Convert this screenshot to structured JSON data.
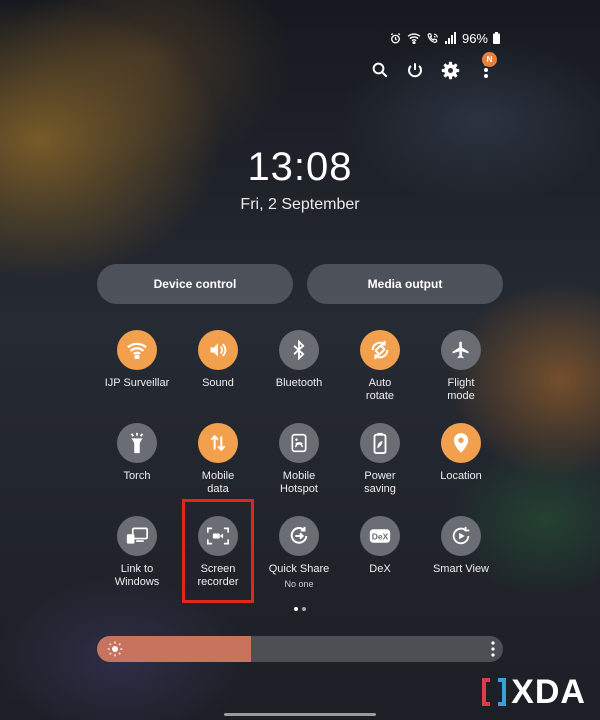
{
  "status_bar": {
    "battery": "96%",
    "icons": [
      "alarm-icon",
      "wifi-icon",
      "wifi-call-icon",
      "signal-icon",
      "battery-icon"
    ]
  },
  "top_actions": [
    "search-icon",
    "power-icon",
    "settings-icon",
    "more-icon"
  ],
  "notification_badge": "N",
  "clock": {
    "time": "13:08",
    "date": "Fri, 2 September"
  },
  "buttons": {
    "device_control": "Device control",
    "media_output": "Media output"
  },
  "tiles": [
    {
      "id": "wifi",
      "label": "IJP Surveillar",
      "icon": "wifi-icon",
      "on": true
    },
    {
      "id": "sound",
      "label": "Sound",
      "icon": "speaker-icon",
      "on": true
    },
    {
      "id": "bluetooth",
      "label": "Bluetooth",
      "icon": "bluetooth-icon",
      "on": false
    },
    {
      "id": "auto-rotate",
      "label": "Auto\nrotate",
      "icon": "rotate-icon",
      "on": true
    },
    {
      "id": "flight-mode",
      "label": "Flight\nmode",
      "icon": "airplane-icon",
      "on": false
    },
    {
      "id": "torch",
      "label": "Torch",
      "icon": "torch-icon",
      "on": false
    },
    {
      "id": "mobile-data",
      "label": "Mobile\ndata",
      "icon": "data-arrows-icon",
      "on": true
    },
    {
      "id": "mobile-hotspot",
      "label": "Mobile\nHotspot",
      "icon": "hotspot-icon",
      "on": false
    },
    {
      "id": "power-saving",
      "label": "Power\nsaving",
      "icon": "battery-leaf-icon",
      "on": false
    },
    {
      "id": "location",
      "label": "Location",
      "icon": "location-pin-icon",
      "on": true
    },
    {
      "id": "link-to-windows",
      "label": "Link to\nWindows",
      "icon": "link-windows-icon",
      "on": false
    },
    {
      "id": "screen-recorder",
      "label": "Screen\nrecorder",
      "icon": "screen-record-icon",
      "on": false
    },
    {
      "id": "quick-share",
      "label": "Quick Share",
      "sub": "No one",
      "icon": "quick-share-icon",
      "on": false
    },
    {
      "id": "dex",
      "label": "DeX",
      "icon": "dex-icon",
      "on": false
    },
    {
      "id": "smart-view",
      "label": "Smart View",
      "icon": "smart-view-icon",
      "on": false
    }
  ],
  "brightness": {
    "level": 0.38
  },
  "watermark": "XDA"
}
